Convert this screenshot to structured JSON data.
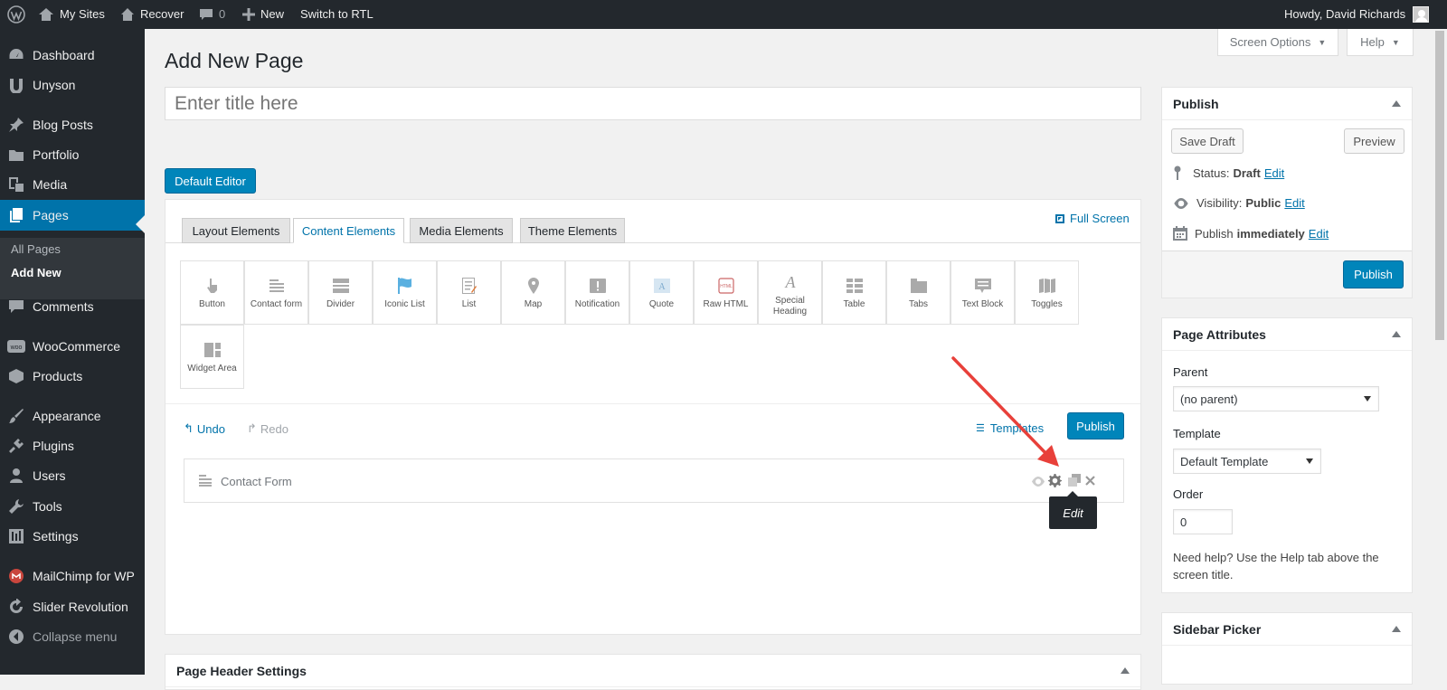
{
  "admin_bar": {
    "my_sites": "My Sites",
    "site_name": "Recover",
    "comments_count": "0",
    "new_label": "New",
    "rtl_label": "Switch to RTL",
    "howdy": "Howdy, David Richards"
  },
  "sidebar": {
    "items": [
      {
        "label": "Dashboard",
        "icon": "dashboard-icon"
      },
      {
        "label": "Unyson",
        "icon": "unyson-icon"
      },
      {
        "label": "Blog Posts",
        "icon": "pin-icon"
      },
      {
        "label": "Portfolio",
        "icon": "folder-icon"
      },
      {
        "label": "Media",
        "icon": "media-icon"
      },
      {
        "label": "Pages",
        "icon": "pages-icon"
      },
      {
        "label": "Comments",
        "icon": "comment-icon"
      },
      {
        "label": "WooCommerce",
        "icon": "woo-icon"
      },
      {
        "label": "Products",
        "icon": "box-icon"
      },
      {
        "label": "Appearance",
        "icon": "brush-icon"
      },
      {
        "label": "Plugins",
        "icon": "plug-icon"
      },
      {
        "label": "Users",
        "icon": "user-icon"
      },
      {
        "label": "Tools",
        "icon": "wrench-icon"
      },
      {
        "label": "Settings",
        "icon": "settings-icon"
      },
      {
        "label": "MailChimp for WP",
        "icon": "mailchimp-icon"
      },
      {
        "label": "Slider Revolution",
        "icon": "refresh-icon"
      },
      {
        "label": "Collapse menu",
        "icon": "collapse-icon"
      }
    ],
    "submenu": {
      "all_pages": "All Pages",
      "add_new": "Add New"
    }
  },
  "screen_options": "Screen Options",
  "help": "Help",
  "page_title": "Add New Page",
  "title_placeholder": "Enter title here",
  "default_editor": "Default Editor",
  "builder": {
    "tabs": [
      "Layout Elements",
      "Content Elements",
      "Media Elements",
      "Theme Elements"
    ],
    "full_screen": "Full Screen",
    "elements": [
      "Button",
      "Contact form",
      "Divider",
      "Iconic List",
      "List",
      "Map",
      "Notification",
      "Quote",
      "Raw HTML",
      "Special Heading",
      "Table",
      "Tabs",
      "Text Block",
      "Toggles",
      "Widget Area"
    ],
    "undo": "Undo",
    "redo": "Redo",
    "templates": "Templates",
    "publish": "Publish",
    "row_item": "Contact Form",
    "tooltip": "Edit"
  },
  "publish_box": {
    "title": "Publish",
    "save_draft": "Save Draft",
    "preview": "Preview",
    "status_label": "Status:",
    "status_value": "Draft",
    "visibility_label": "Visibility:",
    "visibility_value": "Public",
    "publish_label": "Publish",
    "publish_value": "immediately",
    "edit": "Edit",
    "publish_button": "Publish"
  },
  "page_attributes": {
    "title": "Page Attributes",
    "parent_label": "Parent",
    "parent_value": "(no parent)",
    "template_label": "Template",
    "template_value": "Default Template",
    "order_label": "Order",
    "order_value": "0",
    "help_text": "Need help? Use the Help tab above the screen title."
  },
  "sidebar_picker": {
    "title": "Sidebar Picker"
  },
  "page_header_settings": {
    "title": "Page Header Settings"
  },
  "colors": {
    "accent": "#0073aa",
    "button": "#0085ba",
    "annotation_arrow": "#e8403a"
  }
}
